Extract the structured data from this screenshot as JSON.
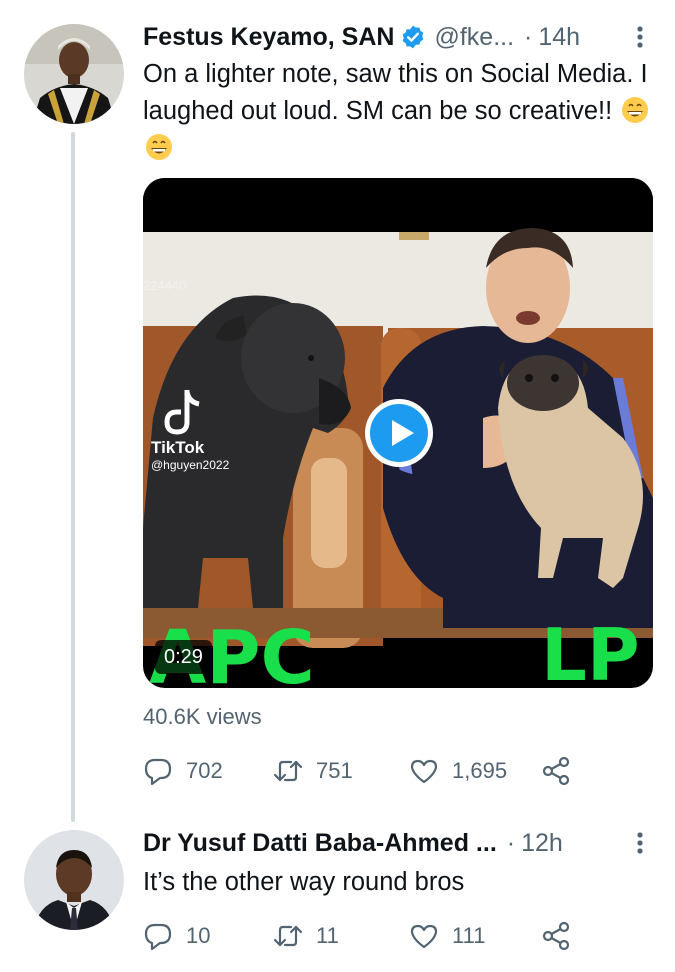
{
  "tweet": {
    "author_name": "Festus Keyamo, SAN",
    "handle": "@fke...",
    "separator": "·",
    "time": "14h",
    "text": "On a lighter note, saw this on Social Media. I laughed out loud. SM can be so creative!!",
    "emojis": [
      "grinning-face-icon",
      "grinning-face-icon"
    ],
    "video": {
      "watermark_number": "224440",
      "tiktok_label": "TikTok",
      "tiktok_user": "@hguyen2022",
      "left_overlay_text": "APC",
      "right_overlay_text": "LP",
      "duration": "0:29"
    },
    "views": "40.6K views",
    "actions": {
      "replies": "702",
      "retweets": "751",
      "likes": "1,695"
    }
  },
  "reply": {
    "author_name": "Dr Yusuf Datti Baba-Ahmed ...",
    "separator": "·",
    "time": "12h",
    "text": "It’s the other way round bros",
    "actions": {
      "replies": "10",
      "retweets": "11",
      "likes": "111"
    }
  },
  "colors": {
    "text_primary": "#0f1419",
    "text_secondary": "#536471",
    "verified_blue": "#1d9bf0",
    "thread_line": "#cfd9de",
    "overlay_green": "#19e04a"
  }
}
